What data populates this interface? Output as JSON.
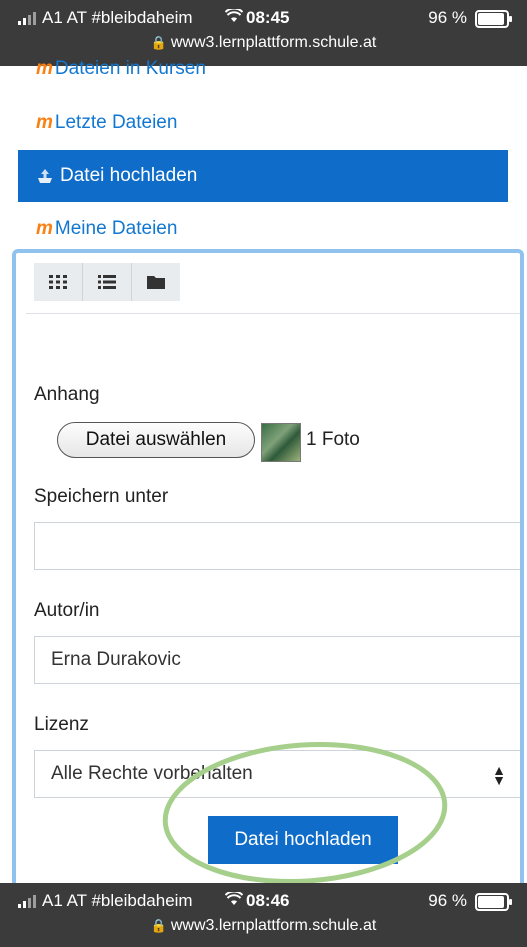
{
  "status_top": {
    "carrier": "A1 AT #bleibdaheim",
    "time": "08:45",
    "battery": "96 %",
    "url": "www3.lernplattform.schule.at"
  },
  "status_bottom": {
    "carrier": "A1 AT #bleibdaheim",
    "time": "08:46",
    "battery": "96 %",
    "url": "www3.lernplattform.schule.at"
  },
  "nav": {
    "items": [
      {
        "label": "Dateien in Kursen",
        "icon": "moodle-logo-icon"
      },
      {
        "label": "Letzte Dateien",
        "icon": "moodle-logo-icon"
      },
      {
        "label": "Datei hochladen",
        "icon": "upload-icon",
        "active": true
      },
      {
        "label": "Meine Dateien",
        "icon": "moodle-logo-icon"
      }
    ]
  },
  "viewbar": {
    "buttons": [
      "grid-view-icon",
      "list-view-icon",
      "folder-view-icon"
    ]
  },
  "form": {
    "attachment_label": "Anhang",
    "choose_file_label": "Datei auswählen",
    "photo_count": "1 Foto",
    "save_as_label": "Speichern unter",
    "save_as_value": "",
    "author_label": "Autor/in",
    "author_value": "Erna Durakovic",
    "license_label": "Lizenz",
    "license_value": "Alle Rechte vorbehalten",
    "submit_label": "Datei hochladen"
  },
  "colors": {
    "accent": "#0f6cc9",
    "link": "#1177d1",
    "moodle_orange": "#f98012",
    "panel_border": "#8fc3ee",
    "annotation": "#a6cf8c"
  }
}
